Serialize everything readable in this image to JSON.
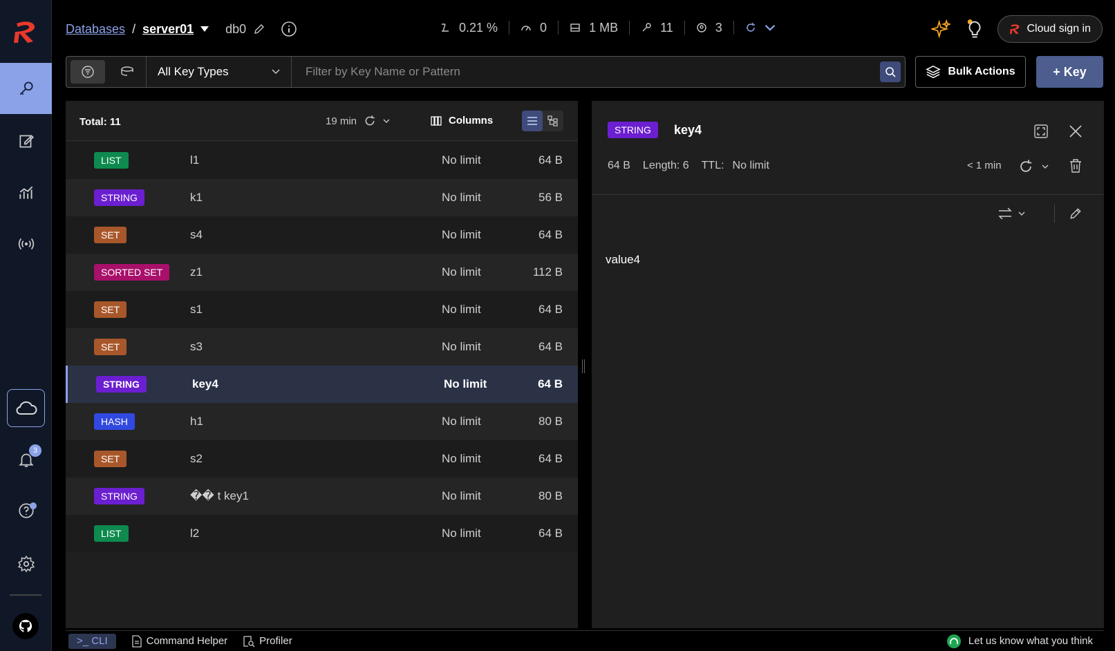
{
  "header": {
    "crumb_databases": "Databases",
    "crumb_separator": "/",
    "crumb_server": "server01",
    "db": "db0",
    "stats": {
      "cpu": "0.21 %",
      "ops": "0",
      "memory": "1 MB",
      "keys": "11",
      "clients": "3"
    },
    "cloud_sign_in": "Cloud sign in"
  },
  "filter": {
    "key_type": "All Key Types",
    "placeholder": "Filter by Key Name or Pattern",
    "bulk_actions": "Bulk Actions",
    "add_key": "+ Key"
  },
  "list": {
    "total": "Total: 11",
    "refreshed": "19 min",
    "columns_label": "Columns",
    "rows": [
      {
        "type": "LIST",
        "color": "#0e8a4f",
        "name": "l1",
        "ttl": "No limit",
        "size": "64 B"
      },
      {
        "type": "STRING",
        "color": "#6b1fd0",
        "name": "k1",
        "ttl": "No limit",
        "size": "56 B"
      },
      {
        "type": "SET",
        "color": "#a8572b",
        "name": "s4",
        "ttl": "No limit",
        "size": "64 B"
      },
      {
        "type": "SORTED SET",
        "color": "#a8106a",
        "name": "z1",
        "ttl": "No limit",
        "size": "112 B"
      },
      {
        "type": "SET",
        "color": "#a8572b",
        "name": "s1",
        "ttl": "No limit",
        "size": "64 B"
      },
      {
        "type": "SET",
        "color": "#a8572b",
        "name": "s3",
        "ttl": "No limit",
        "size": "64 B"
      },
      {
        "type": "STRING",
        "color": "#6b1fd0",
        "name": "key4",
        "ttl": "No limit",
        "size": "64 B"
      },
      {
        "type": "HASH",
        "color": "#3149e0",
        "name": "h1",
        "ttl": "No limit",
        "size": "80 B"
      },
      {
        "type": "SET",
        "color": "#a8572b",
        "name": "s2",
        "ttl": "No limit",
        "size": "64 B"
      },
      {
        "type": "STRING",
        "color": "#6b1fd0",
        "name": "�� t key1",
        "ttl": "No limit",
        "size": "80 B"
      },
      {
        "type": "LIST",
        "color": "#0e8a4f",
        "name": "l2",
        "ttl": "No limit",
        "size": "64 B"
      }
    ],
    "selected_index": 6
  },
  "detail": {
    "type": "STRING",
    "key": "key4",
    "size": "64 B",
    "length": "Length: 6",
    "ttl_label": "TTL:",
    "ttl_value": "No limit",
    "refreshed": "< 1 min",
    "value": "value4"
  },
  "sidebar": {
    "notification_count": "3"
  },
  "bottom": {
    "cli": ">_ CLI",
    "command_helper": "Command Helper",
    "profiler": "Profiler",
    "feedback": "Let us know what you think"
  }
}
